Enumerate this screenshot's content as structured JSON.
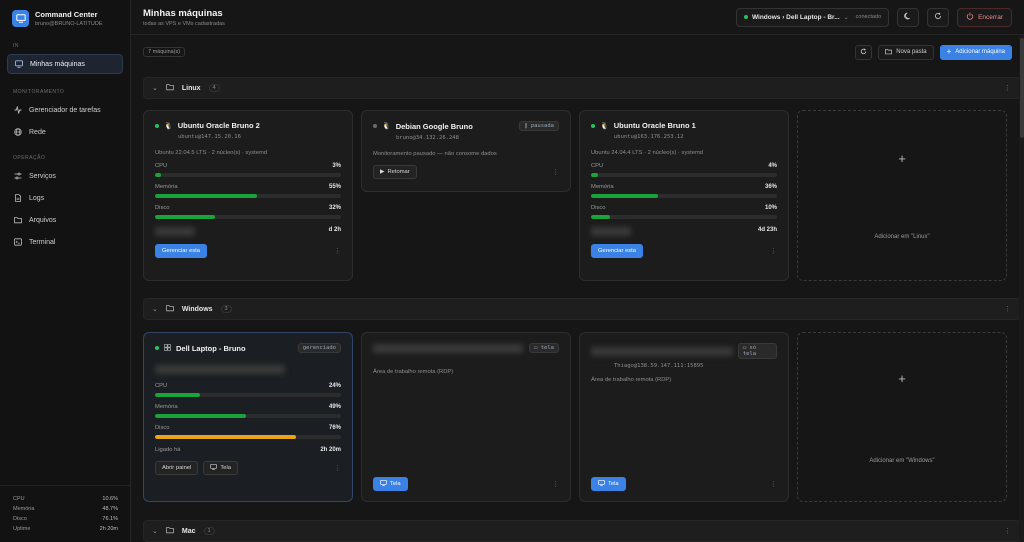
{
  "brand": {
    "title": "Command Center",
    "subtitle": "bruno@BRUNO-LATITUDE"
  },
  "sidebar": {
    "section_main": "IN",
    "item_machines": "Minhas máquinas",
    "section_monitor": "MONITORAMENTO",
    "item_tasks": "Gerenciador de tarefas",
    "item_network": "Rede",
    "section_ops": "OPERAÇÃO",
    "item_services": "Serviços",
    "item_logs": "Logs",
    "item_files": "Arquivos",
    "item_terminal": "Terminal"
  },
  "stats": [
    {
      "label": "CPU",
      "value": "10.6%"
    },
    {
      "label": "Memória",
      "value": "48.7%"
    },
    {
      "label": "Disco",
      "value": "76.1%"
    },
    {
      "label": "Uptime",
      "value": "2h 20m"
    }
  ],
  "header": {
    "title": "Minhas máquinas",
    "subtitle": "todas as VPS e VMs cadastradas",
    "connection_label": "Windows › Dell Laptop - Br...",
    "connection_status": "conectado",
    "end_label": "Encerrar"
  },
  "toolbar": {
    "count": "7 máquina(s)",
    "new_folder": "Nova pasta",
    "add_machine": "Adicionar máquina"
  },
  "groups": {
    "linux": {
      "name": "Linux",
      "count": "4"
    },
    "windows": {
      "name": "Windows",
      "count": "3"
    },
    "mac": {
      "name": "Mac",
      "count": "1"
    }
  },
  "linux_cards": {
    "c1": {
      "name": "Ubuntu Oracle Bruno 2",
      "addr": "ubuntu@147.15.20.16",
      "desc": "Ubuntu 22.04.5 LTS · 2 núcleo(s) · systemd",
      "cpu_label": "CPU",
      "cpu": "3%",
      "cpu_pct": 3,
      "mem_label": "Memória",
      "mem": "55%",
      "mem_pct": 55,
      "disk_label": "Disco",
      "disk": "32%",
      "disk_pct": 32,
      "uptime": "d 2h",
      "manage": "Gerenciar esta"
    },
    "c2": {
      "name": "Debian Google Bruno",
      "badge": "pausada",
      "addr": "bruno@34.132.26.248",
      "desc": "Monitoramento pausado — não consome dados",
      "resume": "Retomar"
    },
    "c3": {
      "name": "Ubuntu Oracle Bruno 1",
      "addr": "ubuntu@163.176.253.12",
      "desc": "Ubuntu 24.04.4 LTS · 2 núcleo(s) · systemd",
      "cpu_label": "CPU",
      "cpu": "4%",
      "cpu_pct": 4,
      "mem_label": "Memória",
      "mem": "36%",
      "mem_pct": 36,
      "disk_label": "Disco",
      "disk": "10%",
      "disk_pct": 10,
      "uptime": "4d 23h",
      "manage": "Gerenciar esta"
    },
    "add": "Adicionar em \"Linux\""
  },
  "windows_cards": {
    "c1": {
      "name": "Dell Laptop - Bruno",
      "badge": "gerenciado",
      "cpu_label": "CPU",
      "cpu": "24%",
      "cpu_pct": 24,
      "mem_label": "Memória",
      "mem": "49%",
      "mem_pct": 49,
      "disk_label": "Disco",
      "disk": "76%",
      "disk_pct": 76,
      "uptime_label": "Ligado há",
      "uptime": "2h 20m",
      "open_panel": "Abrir painel",
      "screen": "Tela"
    },
    "c2": {
      "badge": "tela",
      "desc": "Área de trabalho remota (RDP)",
      "screen": "Tela"
    },
    "c3": {
      "badge": "só tela",
      "addr": "Thiago@138.59.147.111:15895",
      "desc": "Área de trabalho remota (RDP)",
      "screen": "Tela"
    },
    "add": "Adicionar em \"Windows\""
  },
  "icons": {
    "brand": "monitor-icon",
    "machines": "server-icon",
    "tasks": "activity-icon",
    "network": "globe-icon",
    "services": "sliders-icon",
    "logs": "file-text-icon",
    "files": "folder-icon",
    "terminal": "terminal-icon"
  },
  "colors": {
    "accent": "#3b82e6",
    "ok": "#1aa33a",
    "warn": "#e8a317",
    "danger": "#f08a8a"
  }
}
